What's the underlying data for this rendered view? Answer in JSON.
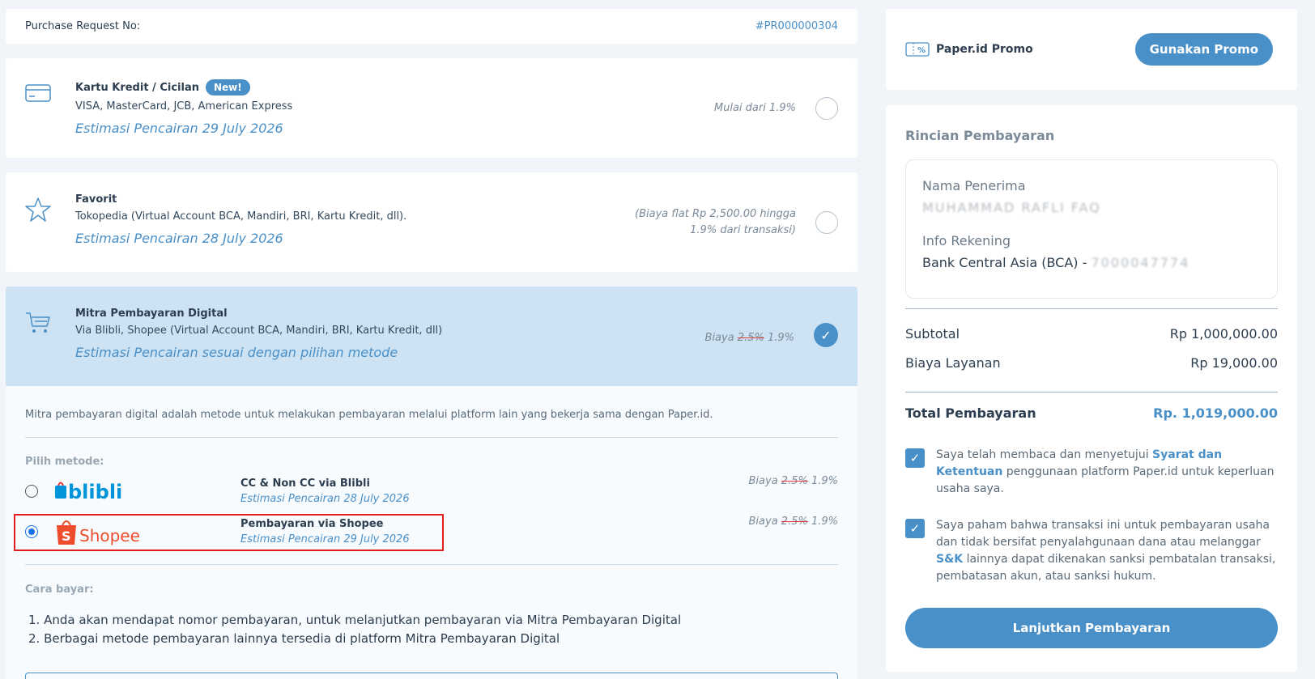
{
  "purchase_request": {
    "label": "Purchase Request No:",
    "number": "#PR000000304"
  },
  "methods": {
    "kartu": {
      "title": "Kartu Kredit / Cicilan",
      "badge": "New!",
      "subtitle": "VISA, MasterCard, JCB, American Express",
      "estimate": "Estimasi Pencairan  29 July 2026",
      "fee": "Mulai dari 1.9%",
      "icon": "credit-card-icon"
    },
    "favorit": {
      "title": "Favorit",
      "subtitle": "Tokopedia (Virtual Account BCA, Mandiri, BRI, Kartu Kredit, dll).",
      "estimate": "Estimasi Pencairan  28 July 2026",
      "fee_line1": "(Biaya flat Rp 2,500.00 hingga",
      "fee_line2": "1.9% dari transaksi)",
      "icon": "star-icon"
    },
    "mitra": {
      "title": "Mitra Pembayaran Digital",
      "subtitle": "Via Blibli, Shopee (Virtual Account BCA, Mandiri, BRI, Kartu Kredit, dll)",
      "estimate": "Estimasi Pencairan sesuai dengan pilihan metode",
      "fee_label": "Biaya",
      "fee_old": "2.5%",
      "fee_new": "1.9%",
      "icon": "shopping-cart-icon"
    }
  },
  "mitra_panel": {
    "description": "Mitra pembayaran digital adalah metode untuk melakukan pembayaran melalui platform lain yang bekerja sama dengan Paper.id.",
    "pilih_label": "Pilih metode:",
    "options": [
      {
        "logo_text": "blibli",
        "title": "CC & Non CC via Blibli",
        "estimate": "Estimasi Pencairan  28 July 2026",
        "fee_label": "Biaya",
        "fee_old": "2.5%",
        "fee_new": "1.9%"
      },
      {
        "logo_text": "Shopee",
        "title": "Pembayaran via Shopee",
        "estimate": "Estimasi Pencairan  29 July 2026",
        "fee_label": "Biaya",
        "fee_old": "2.5%",
        "fee_new": "1.9%"
      }
    ],
    "cara_label": "Cara bayar:",
    "steps": [
      "1. Anda akan mendapat nomor pembayaran, untuk melanjutkan pembayaran via Mitra Pembayaran Digital",
      "2. Berbagai metode pembayaran lainnya tersedia di platform Mitra Pembayaran Digital"
    ]
  },
  "promo": {
    "label": "Paper.id Promo",
    "button": "Gunakan Promo",
    "icon": "promo-ticket-icon"
  },
  "summary": {
    "title": "Rincian Pembayaran",
    "recipient_label": "Nama Penerima",
    "recipient_value": "MUHAMMAD RAFLI FAQ",
    "account_label": "Info Rekening",
    "account_value": "Bank Central Asia (BCA) - ",
    "account_masked": "7000047774",
    "subtotal_label": "Subtotal",
    "subtotal_value": "Rp 1,000,000.00",
    "fee_label": "Biaya Layanan",
    "fee_value": "Rp 19,000.00",
    "total_label": "Total Pembayaran",
    "total_value": "Rp. 1,019,000.00"
  },
  "agreements": {
    "first_pre": "Saya telah membaca dan menyetujui ",
    "first_link": "Syarat dan Ketentuan",
    "first_post": " penggunaan platform Paper.id untuk keperluan usaha saya.",
    "second_pre": "Saya paham bahwa transaksi ini untuk pembayaran usaha dan tidak bersifat penyalahgunaan dana atau melanggar ",
    "second_link": "S&K",
    "second_post": " lainnya dapat dikenakan sanksi pembatalan transaksi, pembatasan akun, atau sanksi hukum."
  },
  "continue_button": "Lanjutkan Pembayaran",
  "colors": {
    "accent": "#4a90c8",
    "selected_bg": "#cde3f3",
    "highlight": "#e01e1e",
    "shopee": "#ee4d2d",
    "blibli": "#0095da"
  }
}
